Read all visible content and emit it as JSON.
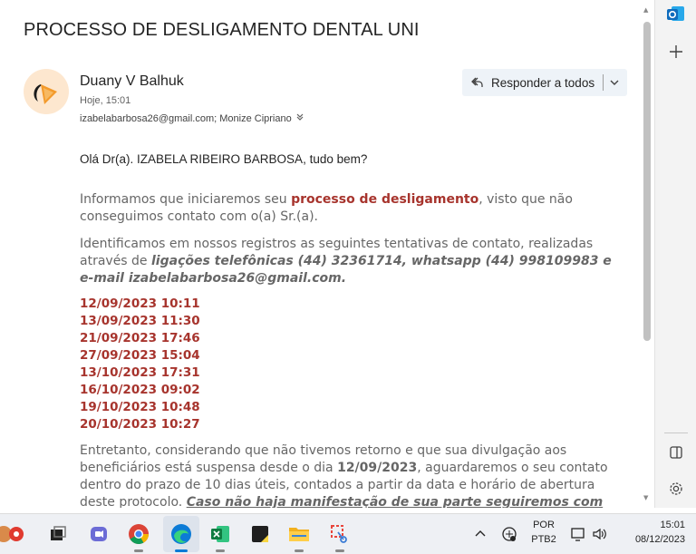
{
  "email": {
    "subject": "PROCESSO DE DESLIGAMENTO DENTAL UNI",
    "sender_name": "Duany V Balhuk",
    "time": "Hoje, 15:01",
    "recipients": "izabelabarbosa26@gmail.com; Monize Cipriano",
    "reply_all_label": "Responder a todos",
    "greeting": "Olá Dr(a). IZABELA RIBEIRO BARBOSA, tudo bem?",
    "p1": {
      "before": "Informamos que iniciaremos seu ",
      "highlight": "processo de desligamento",
      "after": ", visto que não conseguimos contato com o(a) Sr.(a)."
    },
    "p2": {
      "before": "Identificamos em nossos registros as seguintes tentativas de contato, realizadas através de ",
      "highlight": "ligações telefônicas (44) 32361714, whatsapp (44) 998109983 e e-mail izabelabarbosa26@gmail.com."
    },
    "dates": [
      "12/09/2023 10:11",
      "13/09/2023 11:30",
      "21/09/2023 17:46",
      "27/09/2023 15:04",
      "13/10/2023 17:31",
      "16/10/2023 09:02",
      "19/10/2023 10:48",
      "20/10/2023 10:27"
    ],
    "p3": {
      "before": "Entretanto, considerando que não tivemos retorno e que sua divulgação aos beneficiários está suspensa desde o dia ",
      "date": "12/09/2023",
      "middle": ", aguardaremos o seu contato dentro do prazo de 10 dias úteis, contados a partir da data e horário de abertura deste protocolo. ",
      "emphasis": "Caso não haja manifestação de sua parte seguiremos com seu desligamento."
    }
  },
  "taskbar": {
    "lang_line1": "POR",
    "lang_line2": "PTB2",
    "clock_time": "15:01",
    "clock_date": "08/12/2023"
  },
  "colors": {
    "accent_red": "#a7342d",
    "body_gray": "#666666",
    "reply_bg": "#eef3f8",
    "avatar_bg": "#fde7cf",
    "outlook_blue": "#0f6cbd"
  },
  "icons": {
    "reply_all": "reply-all-icon",
    "expand": "chevron-down-icon",
    "outlook": "outlook-icon",
    "add": "plus-icon",
    "side_panel": "side-panel-icon",
    "settings": "gear-icon"
  }
}
